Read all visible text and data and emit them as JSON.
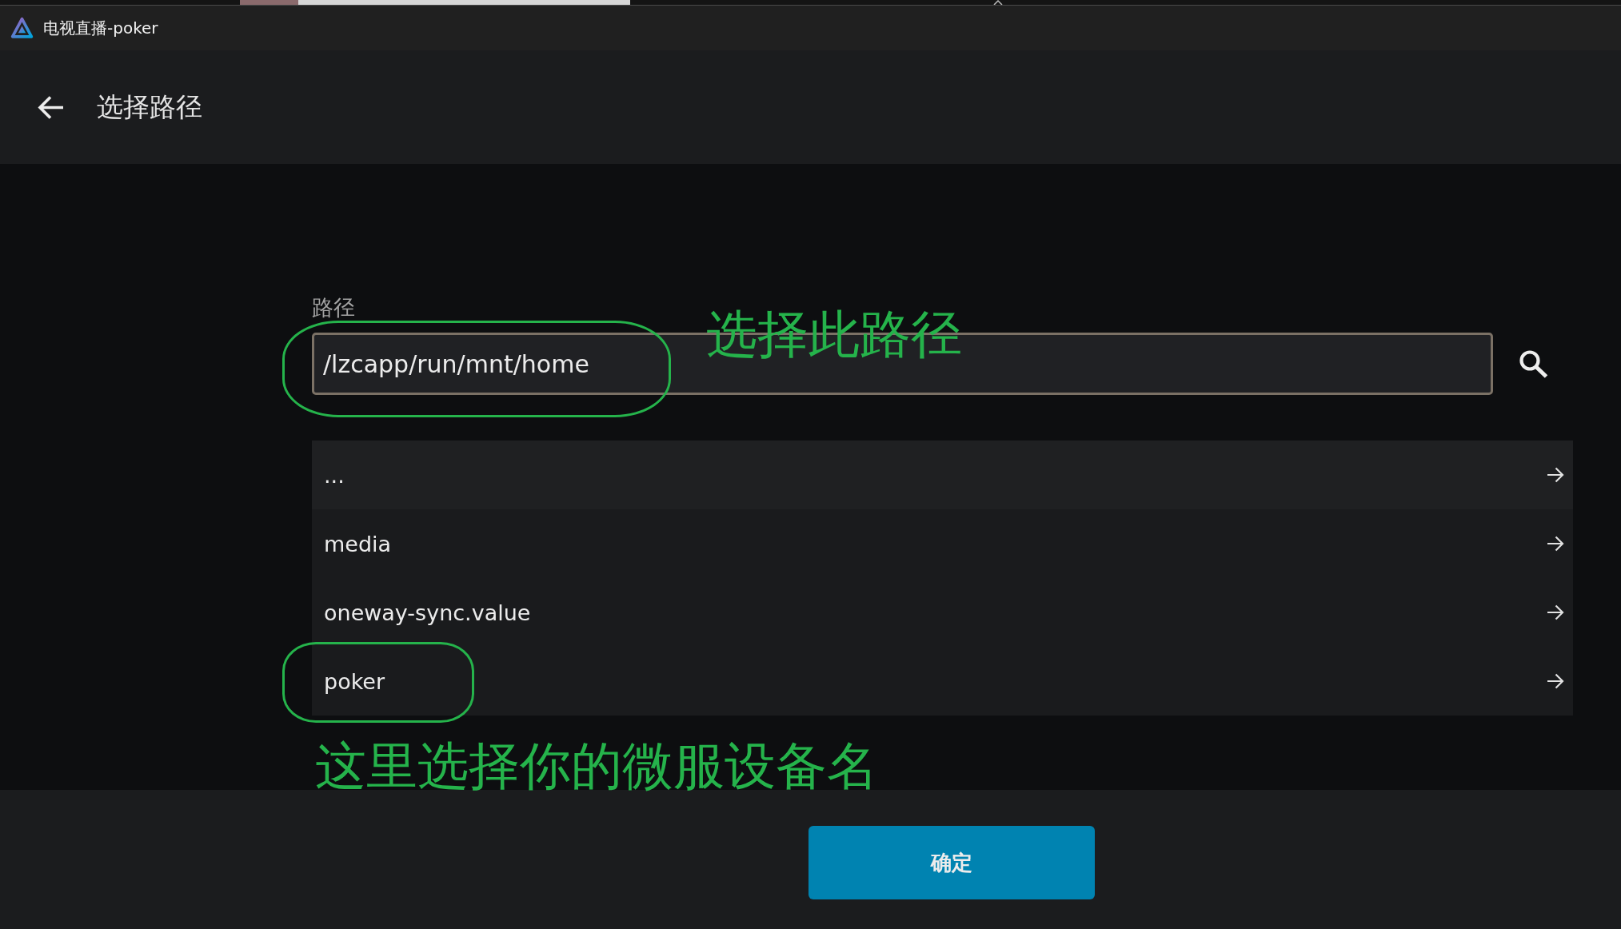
{
  "window": {
    "title": "电视直播-poker"
  },
  "header": {
    "title": "选择路径"
  },
  "path_field": {
    "label": "路径",
    "value": "/lzcapp/run/mnt/home",
    "circled": true,
    "annotation": "选择此路径"
  },
  "entries": [
    {
      "name": "...",
      "focused": true,
      "circled": false
    },
    {
      "name": "media",
      "focused": false,
      "circled": false
    },
    {
      "name": "oneway-sync.value",
      "focused": false,
      "circled": false
    },
    {
      "name": "poker",
      "focused": false,
      "circled": true
    }
  ],
  "entries_annotation": "这里选择你的微服设备名",
  "confirm_button": {
    "label": "确定"
  }
}
